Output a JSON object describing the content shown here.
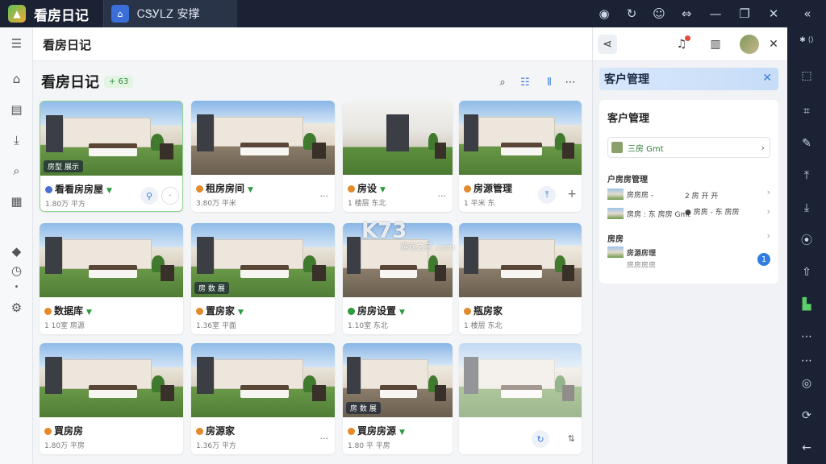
{
  "titlebar": {
    "app_title": "看房日记",
    "tab_label": "ᏟᏕᎩᏞᏃ 安撑",
    "icons": [
      "home-icon",
      "refresh-icon",
      "message-icon",
      "expand-icon",
      "minimize-icon",
      "restore-icon",
      "close-icon",
      "collapse-icon"
    ]
  },
  "leftnav": {
    "items": [
      "menu-icon",
      "home-icon",
      "folder-icon",
      "download-icon",
      "search-icon",
      "chart-icon",
      "diamond-icon",
      "clock-icon",
      "pin-icon",
      "settings-icon"
    ]
  },
  "header": {
    "title": "看房日记"
  },
  "page": {
    "title": "看房日记",
    "badge": "+ 63"
  },
  "cards": [
    {
      "tag": "房型 展示",
      "name": "看看房房屋",
      "meta": "1.80万 平方",
      "dot": "#4a6fd1"
    },
    {
      "tag": "",
      "name": "租房房间",
      "meta": "3.80万 平米",
      "dot": "#e38a2a"
    },
    {
      "tag": "",
      "name": "房设",
      "meta": "1 楼层 东北",
      "dot": "#e38a2a"
    },
    {
      "tag": "",
      "name": "房源管理",
      "meta": "1 平米 东",
      "dot": "#e38a2a"
    },
    {
      "tag": "",
      "name": "数据库",
      "meta": "1 10室 房源",
      "dot": "#e38a2a"
    },
    {
      "tag": "房 数 展",
      "name": "置房家",
      "meta": "1.36室 平面",
      "dot": "#e38a2a"
    },
    {
      "tag": "",
      "name": "房房设置",
      "meta": "1.10室 东北",
      "dot": "#2e9b3e"
    },
    {
      "tag": "",
      "name": "瓶房家",
      "meta": "1 楼层 东北",
      "dot": "#e38a2a"
    },
    {
      "tag": "",
      "name": "買房房",
      "meta": "1.80万 平房",
      "dot": "#e38a2a"
    },
    {
      "tag": "",
      "name": "房源家",
      "meta": "1.36万 平方",
      "dot": "#e38a2a"
    },
    {
      "tag": "房 数 展",
      "name": "買房房源",
      "meta": "1.80 平 平房",
      "dot": "#e38a2a"
    },
    {
      "tag": "",
      "name": "",
      "meta": "",
      "dot": "#e38a2a"
    }
  ],
  "right_panel": {
    "header_title": "客户管理",
    "card_title": "客户管理",
    "top_row_label": "三房 Gmt",
    "section1": "户房房管理",
    "item1_a": "房房房 -",
    "item1_b": "2 房 开 开",
    "item2_a": "房房 : 东 房房 Gmt",
    "item2_b": "● 房房 - 东 房房",
    "section2": "房房",
    "item3_title": "房源房理",
    "item3_sub": "房房房房",
    "notify_count": "1"
  },
  "watermark": {
    "main": "K73",
    "sub": "游戏之家 .com"
  }
}
